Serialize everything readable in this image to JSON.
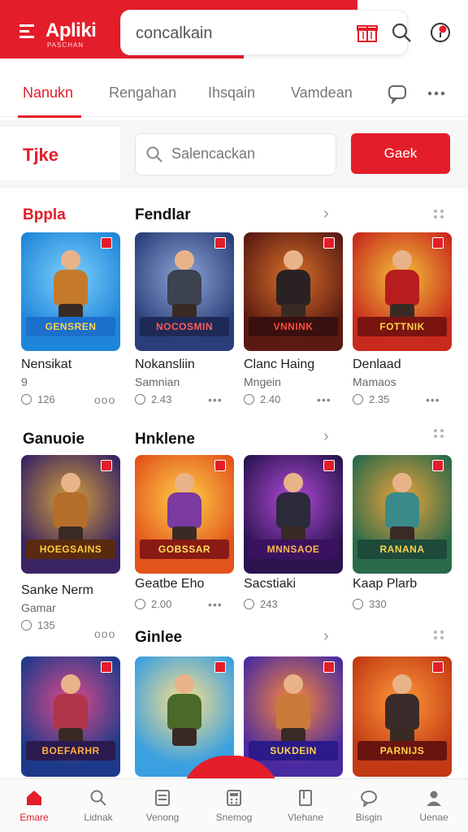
{
  "header": {
    "app_title": "Apliki",
    "app_subtitle": "PASCHAN",
    "search_text": "concalkain",
    "gift_icon": "gift-icon",
    "search_icon": "search-icon",
    "notification_icon": "notification-icon",
    "brand_color": "#e41d2a"
  },
  "tabs": [
    {
      "label": "Nanukn",
      "active": true
    },
    {
      "label": "Rengahan",
      "active": false
    },
    {
      "label": "Ihsqain",
      "active": false
    },
    {
      "label": "Vamdean",
      "active": false
    }
  ],
  "tab_icons": [
    "chat-icon",
    "more-icon"
  ],
  "filter": {
    "chip_label": "Tjke",
    "search_placeholder": "Salencackan",
    "button_label": "Gaek"
  },
  "sections": [
    {
      "label": "Bppla",
      "red": true
    },
    {
      "label": "Fendlar"
    },
    {
      "label": "Ganuoie"
    },
    {
      "label": "Hnklene"
    },
    {
      "label": "Ginlee"
    }
  ],
  "games_row1": [
    {
      "thumb_title": "GENSREN",
      "name": "Nensikat",
      "sub": "9",
      "rating": "126",
      "more": "ооо",
      "colors": [
        "#1e86d8",
        "#7fd0ff"
      ],
      "fig": "#c47a2a",
      "band": "#1d6fcc",
      "band_text": "#ffd34d"
    },
    {
      "thumb_title": "NOCOSMIN",
      "name": "Nokansliin",
      "sub": "Samnian",
      "rating": "2.43",
      "more": "•••",
      "colors": [
        "#2a3f7a",
        "#8fa6d6"
      ],
      "fig": "#3c4250",
      "band": "#1e2a55",
      "band_text": "#ff5a5a"
    },
    {
      "thumb_title": "VNNINK",
      "name": "Clanc Haing",
      "sub": "Mngein",
      "rating": "2.40",
      "more": "•••",
      "colors": [
        "#5a1a12",
        "#d9702a"
      ],
      "fig": "#2a2222",
      "band": "#3a0f0f",
      "band_text": "#ff4a3a"
    },
    {
      "thumb_title": "FOTTNIK",
      "name": "Denlaad",
      "sub": "Mamaos",
      "rating": "2.35",
      "more": "•••",
      "colors": [
        "#c82a1c",
        "#f3c33a"
      ],
      "fig": "#b81d1d",
      "band": "#7a1410",
      "band_text": "#ffd24a"
    }
  ],
  "games_row2": [
    {
      "thumb_title": "HOEGSAINS",
      "name": "Sanke Nerm",
      "sub": "Gamar",
      "rating": "135",
      "more": "ооо",
      "colors": [
        "#3a2464",
        "#d6a13a"
      ],
      "fig": "#b56d2a",
      "band": "#5a2a10",
      "band_text": "#ffcf3a"
    },
    {
      "thumb_title": "GOBSSAR",
      "name": "Geatbe Eho",
      "sub": "",
      "rating": "2.00",
      "more": "•••",
      "colors": [
        "#e2541a",
        "#ffd04a"
      ],
      "fig": "#7a3aa0",
      "band": "#8a1a14",
      "band_text": "#ffe05a"
    },
    {
      "thumb_title": "MNNSAOE",
      "name": "Sacstiaki",
      "sub": "",
      "rating": "243",
      "more": "",
      "colors": [
        "#2b1450",
        "#b24bd8"
      ],
      "fig": "#2a2a3a",
      "band": "#3a1260",
      "band_text": "#ffb84a"
    },
    {
      "thumb_title": "RANANA",
      "name": "Kaap Plarb",
      "sub": "",
      "rating": "330",
      "more": "",
      "colors": [
        "#2a6a4a",
        "#f0a43a"
      ],
      "fig": "#3a8a8a",
      "band": "#1d4a3a",
      "band_text": "#ffd24a"
    }
  ],
  "games_row3": [
    {
      "thumb_title": "BOEFARHR",
      "colors": [
        "#1d3a8a",
        "#e24a8a"
      ],
      "fig": "#b0344a",
      "band": "#2a1a50",
      "band_text": "#ffb03a"
    },
    {
      "thumb_title": "",
      "colors": [
        "#3aa0e0",
        "#ffe08a"
      ],
      "fig": "#4a6a2a",
      "band": "#3aa0e0",
      "band_text": "#ffffff"
    },
    {
      "thumb_title": "SUKDEIN",
      "colors": [
        "#4a2aa0",
        "#ff8a3a"
      ],
      "fig": "#c97a3a",
      "band": "#2a1a8a",
      "band_text": "#ffd24a"
    },
    {
      "thumb_title": "PARNIJS",
      "colors": [
        "#c23a14",
        "#ff9a3a"
      ],
      "fig": "#3a2a2a",
      "band": "#6a1410",
      "band_text": "#ffd24a"
    }
  ],
  "bottom_nav": [
    {
      "label": "Emare",
      "icon": "home-icon",
      "active": true
    },
    {
      "label": "Lidnak",
      "icon": "search-icon",
      "active": false
    },
    {
      "label": "Venong",
      "icon": "list-icon",
      "active": false
    },
    {
      "label": "Snemog",
      "icon": "calculator-icon",
      "active": false
    },
    {
      "label": "Vlehane",
      "icon": "book-icon",
      "active": false
    },
    {
      "label": "Bisgin",
      "icon": "chat-icon",
      "active": false
    },
    {
      "label": "Uenae",
      "icon": "profile-icon",
      "active": false
    }
  ]
}
